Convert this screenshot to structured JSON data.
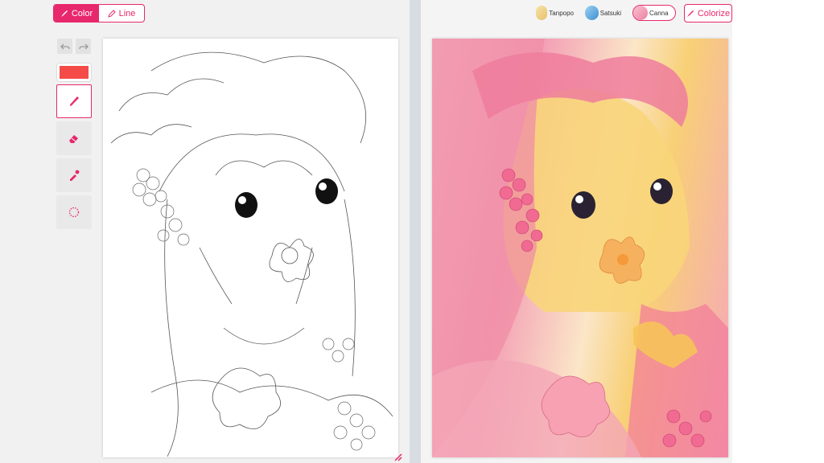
{
  "mode_toggle": {
    "color_label": "Color",
    "line_label": "Line",
    "active": "Color"
  },
  "toolbar": {
    "undo_icon": "undo-icon",
    "redo_icon": "redo-icon",
    "current_color": "#f44b48",
    "tools": [
      {
        "icon": "brush-icon",
        "active": true
      },
      {
        "icon": "eraser-icon",
        "active": false
      },
      {
        "icon": "eyedropper-icon",
        "active": false
      },
      {
        "icon": "dotted-circle-icon",
        "active": false
      }
    ]
  },
  "styles": {
    "items": [
      {
        "label": "Tanpopo",
        "selected": false
      },
      {
        "label": "Satsuki",
        "selected": false
      },
      {
        "label": "Canna",
        "selected": true
      }
    ]
  },
  "colorize_button": {
    "label": "Colorize"
  },
  "colors": {
    "accent": "#e8286c",
    "brush_color": "#f44b48"
  }
}
